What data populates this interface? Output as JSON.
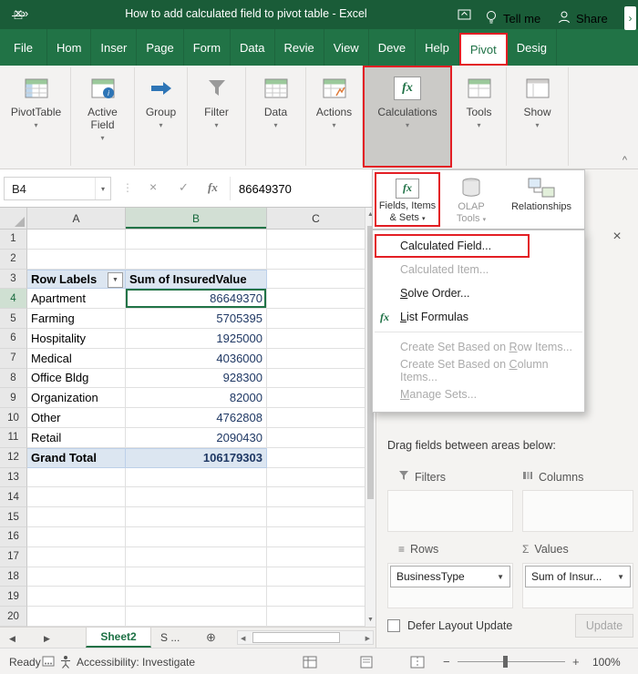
{
  "icons": {
    "quick_access": "»",
    "minimize": "—",
    "maximize": "□",
    "close": "×",
    "dropdown": "▾",
    "up_arrow": "▲",
    "down_arrow": "▼",
    "left_arrow": "◀",
    "right_arrow": "▶",
    "check": "✓",
    "cancel": "×",
    "fx": "fx",
    "sigma": "Σ",
    "rows_lines": "≡",
    "add_sheet": "⊕",
    "dots": "⋮",
    "collapse": "^",
    "tab_overflow": "›",
    "pane_close": "×",
    "minus": "−",
    "plus": "+"
  },
  "titlebar": {
    "title": "How to add calculated field to pivot table - Excel"
  },
  "ribbon": {
    "tabs": [
      "File",
      "Hom",
      "Inser",
      "Page",
      "Form",
      "Data",
      "Revie",
      "View",
      "Deve",
      "Help",
      "Pivot",
      "Desig"
    ],
    "tell_me": "Tell me",
    "share": "Share",
    "groups": [
      {
        "label": "PivotTable"
      },
      {
        "label": "Active",
        "label2": "Field"
      },
      {
        "label": "Group"
      },
      {
        "label": "Filter"
      },
      {
        "label": "Data"
      },
      {
        "label": "Actions"
      },
      {
        "label": "Calculations"
      },
      {
        "label": "Tools"
      },
      {
        "label": "Show"
      }
    ]
  },
  "formula_bar": {
    "cell_ref": "B4",
    "value": "86649370"
  },
  "grid": {
    "columns": [
      "A",
      "B",
      "C"
    ],
    "row_count": 20,
    "selected_row": 4,
    "pivot": {
      "header": {
        "col_a": "Row Labels",
        "col_b": "Sum of InsuredValue"
      },
      "rows": [
        {
          "label": "Apartment",
          "value": "86649370"
        },
        {
          "label": "Farming",
          "value": "5705395"
        },
        {
          "label": "Hospitality",
          "value": "1925000"
        },
        {
          "label": "Medical",
          "value": "4036000"
        },
        {
          "label": "Office Bldg",
          "value": "928300"
        },
        {
          "label": "Organization",
          "value": "82000"
        },
        {
          "label": "Other",
          "value": "4762808"
        },
        {
          "label": "Retail",
          "value": "2090430"
        },
        {
          "label": "Grand Total",
          "value": "106179303"
        }
      ]
    }
  },
  "flyout": {
    "items": [
      {
        "line1": "Fields, Items",
        "line2": "& Sets"
      },
      {
        "line1": "OLAP",
        "line2": "Tools"
      },
      {
        "line1": "Relationships",
        "line2": ""
      }
    ]
  },
  "menu": {
    "items": [
      {
        "label": "Calculated Field..."
      },
      {
        "label": "Calculated Item..."
      },
      {
        "label": "Solve Order..."
      },
      {
        "label": "List Formulas"
      },
      {
        "label": "Create Set Based on Row Items..."
      },
      {
        "label": "Create Set Based on Column Items..."
      },
      {
        "label": "Manage Sets..."
      }
    ]
  },
  "fields_pane": {
    "drag_label": "Drag fields between areas below:",
    "filters_label": "Filters",
    "columns_label": "Columns",
    "rows_label": "Rows",
    "values_label": "Values",
    "rows_field": "BusinessType",
    "values_field": "Sum of Insur...",
    "defer_label": "Defer Layout Update",
    "update_label": "Update"
  },
  "sheet_bar": {
    "tabs": [
      {
        "label": "Sheet2"
      },
      {
        "label": "S ..."
      }
    ]
  },
  "status_bar": {
    "ready": "Ready",
    "accessibility": "Accessibility: Investigate",
    "zoom": "100%"
  }
}
